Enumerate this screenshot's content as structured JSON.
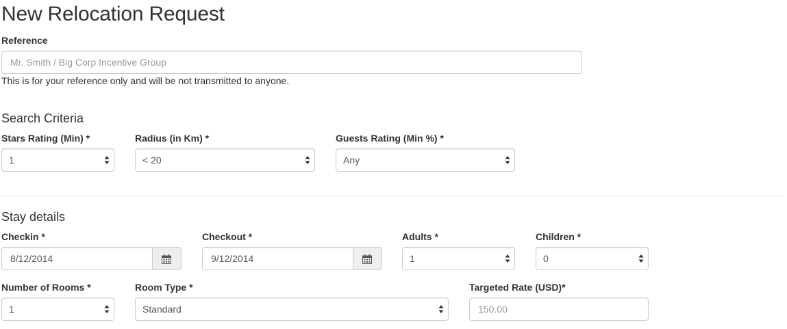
{
  "page": {
    "title": "New Relocation Request"
  },
  "reference": {
    "label": "Reference",
    "placeholder": "Mr. Smith / Big Corp Incentive Group",
    "help": "This is for your reference only and will be not transmitted to anyone."
  },
  "search_criteria": {
    "heading": "Search Criteria",
    "stars": {
      "label": "Stars Rating (Min) *",
      "value": "1"
    },
    "radius": {
      "label": "Radius (in Km) *",
      "value": "< 20"
    },
    "guests": {
      "label": "Guests Rating (Min %) *",
      "value": "Any"
    }
  },
  "stay": {
    "heading": "Stay details",
    "checkin": {
      "label": "Checkin *",
      "value": "8/12/2014",
      "icon": "calendar-icon"
    },
    "checkout": {
      "label": "Checkout *",
      "value": "9/12/2014",
      "icon": "calendar-icon"
    },
    "adults": {
      "label": "Adults *",
      "value": "1"
    },
    "children": {
      "label": "Children *",
      "value": "0"
    },
    "rooms": {
      "label": "Number of Rooms *",
      "value": "1"
    },
    "room_type": {
      "label": "Room Type *",
      "value": "Standard"
    },
    "rate": {
      "label": "Targeted Rate (USD)*",
      "placeholder": "150.00"
    }
  }
}
